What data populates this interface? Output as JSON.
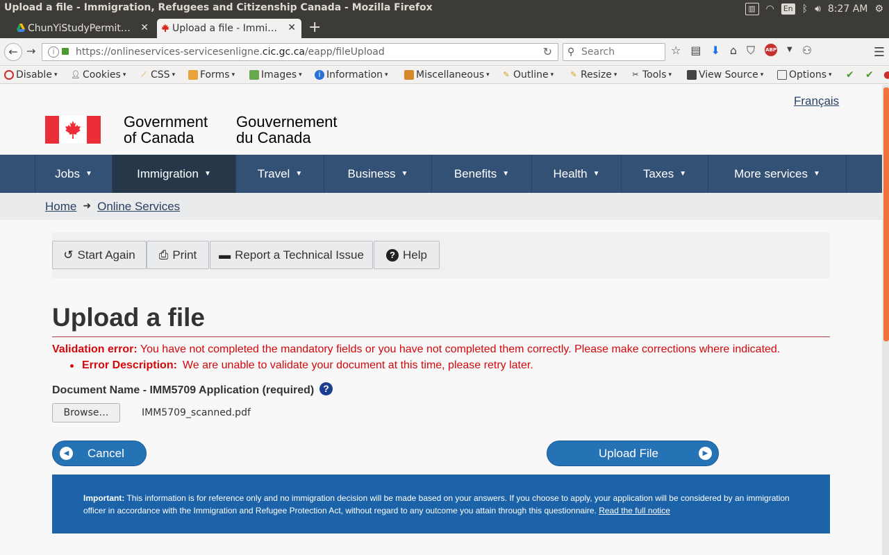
{
  "os": {
    "window_title": "Upload a file - Immigration, Refugees and Citizenship Canada - Mozilla Firefox",
    "keyboard": "En",
    "clock": "8:27 AM"
  },
  "tabs": [
    {
      "label": "ChunYiStudyPermit…"
    },
    {
      "label": "Upload a file - Immi…"
    }
  ],
  "nav": {
    "url_prefix": "https://onlineservices-servicesenligne.",
    "url_host": "cic.gc.ca",
    "url_path": "/eapp/fileUpload",
    "search_placeholder": "Search",
    "abp_label": "ABP"
  },
  "dev_toolbar": [
    {
      "label": "Disable"
    },
    {
      "label": "Cookies"
    },
    {
      "label": "CSS"
    },
    {
      "label": "Forms"
    },
    {
      "label": "Images"
    },
    {
      "label": "Information"
    },
    {
      "label": "Miscellaneous"
    },
    {
      "label": "Outline"
    },
    {
      "label": "Resize"
    },
    {
      "label": "Tools"
    },
    {
      "label": "View Source"
    },
    {
      "label": "Options"
    }
  ],
  "header": {
    "lang_toggle": "Français",
    "gov_en_line1": "Government",
    "gov_en_line2": "of Canada",
    "gov_fr_line1": "Gouvernement",
    "gov_fr_line2": "du Canada"
  },
  "menu": [
    {
      "label": "Jobs"
    },
    {
      "label": "Immigration"
    },
    {
      "label": "Travel"
    },
    {
      "label": "Business"
    },
    {
      "label": "Benefits"
    },
    {
      "label": "Health"
    },
    {
      "label": "Taxes"
    },
    {
      "label": "More services"
    }
  ],
  "breadcrumb": [
    {
      "label": "Home"
    },
    {
      "label": "Online Services"
    }
  ],
  "actions": {
    "start_again": "Start Again",
    "print": "Print",
    "report_issue": "Report a Technical Issue",
    "help": "Help"
  },
  "form": {
    "title": "Upload a file",
    "validation_label": "Validation error:",
    "validation_message": " You have not completed the mandatory fields or you have not completed them correctly. Please make corrections where indicated.",
    "error_label": "Error Description:",
    "error_message": "We are unable to validate your document at this time, please retry later.",
    "document_label": "Document Name - IMM5709 Application (required)",
    "help_glyph": "?",
    "browse_label": "Browse…",
    "file_name": "IMM5709_scanned.pdf",
    "cancel_label": "Cancel",
    "upload_label": "Upload File"
  },
  "notice": {
    "label": "Important:",
    "text": " This information is for reference only and no immigration decision will be made based on your answers. If you choose to apply, your application will be considered by an immigration officer in accordance with the Immigration and Refugee Protection Act, without regard to any outcome you attain through this questionnaire. ",
    "link": "Read the full notice"
  },
  "colors": {
    "menu_bg": "#335075",
    "menu_active": "#26374a",
    "error": "#d3080c",
    "primary_button": "#2572b4",
    "notice_bg": "#1c62a8",
    "flag_red": "#eb2d37"
  }
}
